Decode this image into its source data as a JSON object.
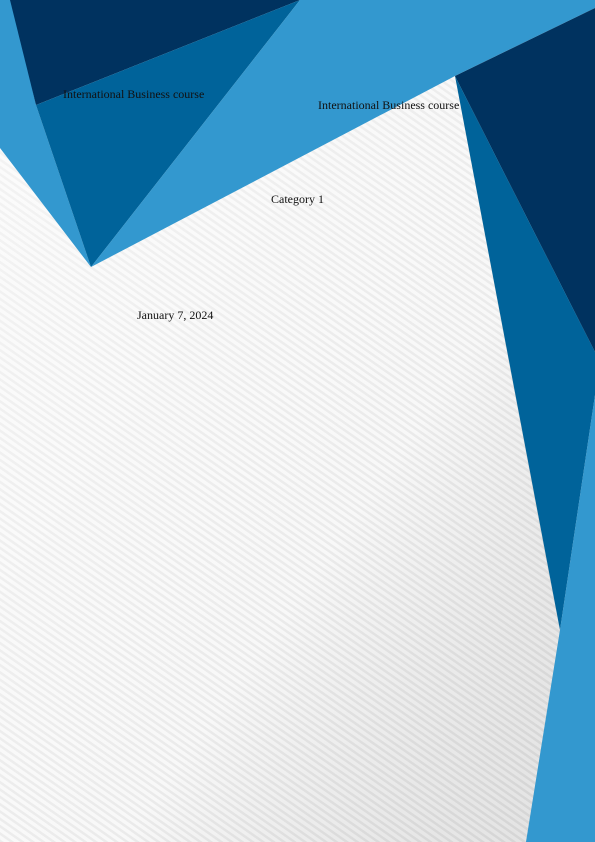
{
  "cover": {
    "title_left": "International Business course",
    "title_right": "International Business course",
    "category": "Category 1",
    "date": "January 7, 2024"
  },
  "colors": {
    "navy": "#00325f",
    "mid_blue": "#00639a",
    "light_blue": "#3398cf",
    "paper": "#f5f5f5"
  }
}
